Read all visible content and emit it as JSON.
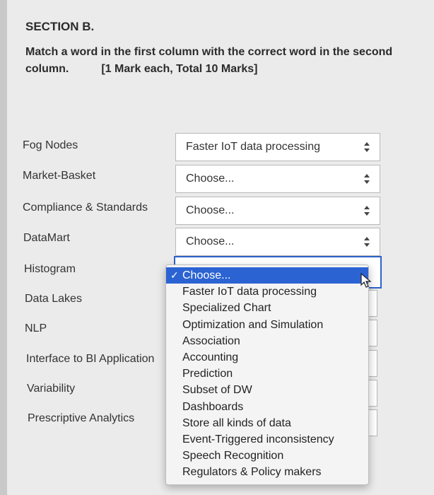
{
  "header": {
    "section": "SECTION B.",
    "instruction_line1": "Match a word in the first column with the correct word in the second",
    "instruction_line2": "column.",
    "marks": "[1 Mark each, Total 10 Marks]"
  },
  "rows": [
    {
      "label": "Fog Nodes",
      "value": "Faster IoT data processing"
    },
    {
      "label": "Market-Basket",
      "value": "Choose..."
    },
    {
      "label": "Compliance & Standards",
      "value": "Choose..."
    },
    {
      "label": "DataMart",
      "value": "Choose..."
    },
    {
      "label": "Histogram"
    },
    {
      "label": "Data Lakes"
    },
    {
      "label": "NLP"
    },
    {
      "label": "Interface to BI Application"
    },
    {
      "label": "Variability"
    },
    {
      "label": "Prescriptive Analytics"
    }
  ],
  "dropdown": {
    "check_mark": "✓",
    "options": [
      "Choose...",
      "Faster IoT data processing",
      "Specialized Chart",
      "Optimization and Simulation",
      "Association",
      "Accounting",
      "Prediction",
      "Subset of DW",
      "Dashboards",
      "Store all kinds of data",
      "Event-Triggered inconsistency",
      "Speech Recognition",
      "Regulators & Policy makers"
    ]
  },
  "icons": {
    "select_arrows": "updown-arrows-icon",
    "cursor": "mouse-pointer-icon"
  },
  "colors": {
    "selected_option": "#2b63d2",
    "focus_border": "#2d62c8"
  }
}
